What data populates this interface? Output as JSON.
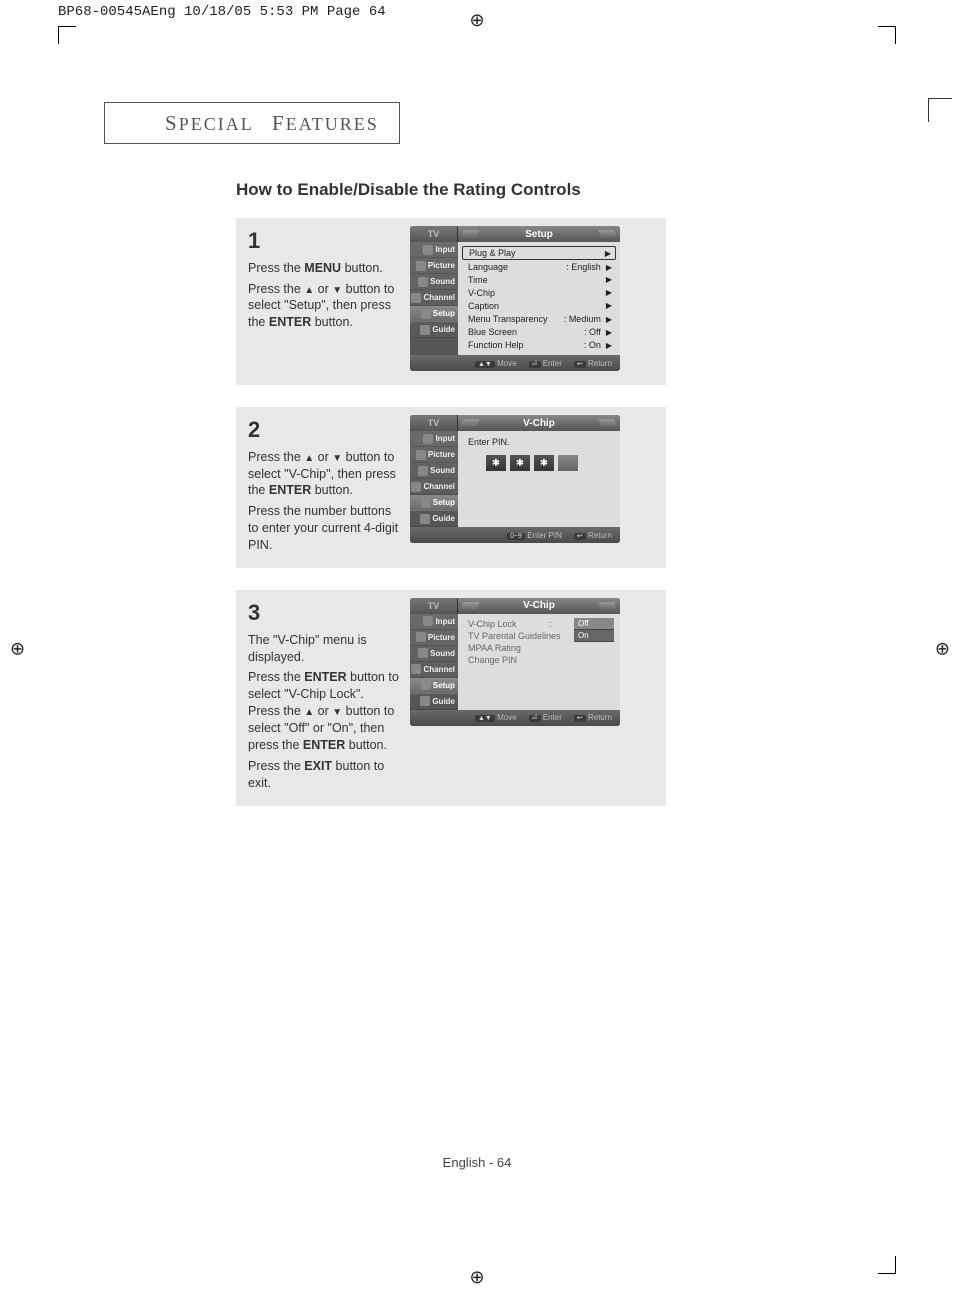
{
  "print_header": "BP68-00545AEng  10/18/05  5:53 PM  Page 64",
  "section_title_1": "S",
  "section_title_2": "PECIAL",
  "section_title_3": "F",
  "section_title_4": "EATURES",
  "howto_title": "How to Enable/Disable the Rating Controls",
  "footer": "English - 64",
  "steps": {
    "s1": {
      "num": "1",
      "p1a": "Press the ",
      "p1b": "MENU",
      "p1c": " button.",
      "p2a": "Press the  ",
      "p2b": " or ",
      "p2c": " button to select \"Setup\", then press the ",
      "p2d": "ENTER",
      "p2e": " button."
    },
    "s2": {
      "num": "2",
      "p1a": "Press the ",
      "p1b": " or ",
      "p1c": " button to select \"V-Chip\", then press the ",
      "p1d": "ENTER",
      "p1e": " button.",
      "p2": "Press the number buttons to enter your current 4-digit PIN."
    },
    "s3": {
      "num": "3",
      "p1": "The \"V-Chip\" menu is displayed.",
      "p2a": "Press the ",
      "p2b": "ENTER",
      "p2c": " button to select \"V-Chip Lock\".",
      "p3a": "Press the ",
      "p3b": " or ",
      "p3c": " button to select \"Off\" or \"On\", then press the ",
      "p3d": "ENTER",
      "p3e": " button.",
      "p4a": "Press the ",
      "p4b": "EXIT",
      "p4c": " button to exit."
    }
  },
  "osd": {
    "tv": "TV",
    "side": {
      "input": "Input",
      "picture": "Picture",
      "sound": "Sound",
      "channel": "Channel",
      "setup": "Setup",
      "guide": "Guide"
    },
    "footer": {
      "move": "Move",
      "enter": "Enter",
      "return": "Return",
      "enterpin": "Enter PIN",
      "zeronine": "0~9"
    },
    "screen1": {
      "title": "Setup",
      "rows": {
        "r0": "Plug & Play",
        "r1l": "Language",
        "r1v": ": English",
        "r2": "Time",
        "r3": "V-Chip",
        "r4": "Caption",
        "r5l": "Menu Transparency",
        "r5v": ": Medium",
        "r6l": "Blue Screen",
        "r6v": ": Off",
        "r7l": "Function Help",
        "r7v": ": On"
      }
    },
    "screen2": {
      "title": "V-Chip",
      "prompt": "Enter PIN.",
      "star": "✱"
    },
    "screen3": {
      "title": "V-Chip",
      "r0": "V-Chip Lock",
      "r0v": ":",
      "opt_off": "Off",
      "opt_on": "On",
      "r1": "TV Parental Guidelines",
      "r2": "MPAA Rating",
      "r3": "Change PIN"
    }
  }
}
